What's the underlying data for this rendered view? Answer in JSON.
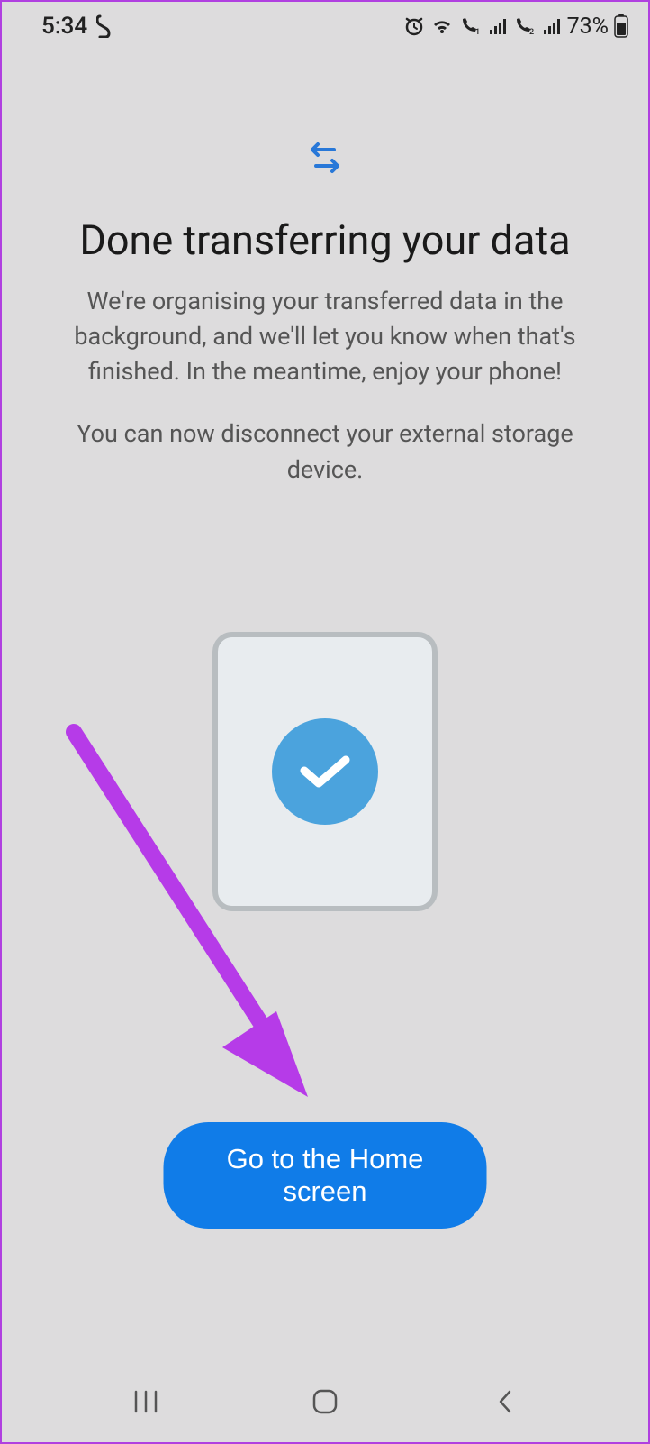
{
  "status": {
    "time": "5:34",
    "battery": "73%"
  },
  "content": {
    "title": "Done transferring your data",
    "description": "We're organising your transferred data in the background, and we'll let you know when that's finished. In the meantime, enjoy your phone!",
    "subdescription": "You can now disconnect your external storage device."
  },
  "button": {
    "label": "Go to the Home screen"
  }
}
